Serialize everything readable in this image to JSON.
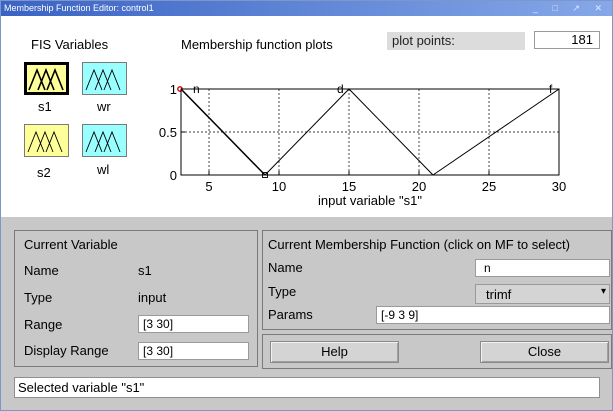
{
  "window": {
    "title": "Membership Function Editor: control1",
    "controls": "_ □ ↗ ✕"
  },
  "fis": {
    "heading": "FIS Variables",
    "variables": [
      {
        "name": "s1",
        "color": "#ffff99",
        "selected": true
      },
      {
        "name": "wr",
        "color": "#99ffff",
        "selected": false
      },
      {
        "name": "s2",
        "color": "#ffff99",
        "selected": false
      },
      {
        "name": "wl",
        "color": "#99ffff",
        "selected": false
      }
    ]
  },
  "plot": {
    "heading": "Membership function plots",
    "plot_points_label": "plot points:",
    "plot_points_value": "181",
    "xlabel": "input variable \"s1\"",
    "xticks": [
      "5",
      "10",
      "15",
      "20",
      "25",
      "30"
    ],
    "yticks": [
      "0",
      "0.5",
      "1"
    ]
  },
  "chart_data": {
    "type": "line",
    "xlabel": "input variable \"s1\"",
    "ylabel": "",
    "xlim": [
      3,
      30
    ],
    "ylim": [
      0,
      1
    ],
    "grid": true,
    "series": [
      {
        "name": "n",
        "x": [
          -9,
          3,
          9
        ],
        "y": [
          0,
          1,
          0
        ]
      },
      {
        "name": "d",
        "x": [
          9,
          15,
          21
        ],
        "y": [
          0,
          1,
          0
        ]
      },
      {
        "name": "f",
        "x": [
          21,
          30
        ],
        "y": [
          0,
          1
        ]
      }
    ]
  },
  "current_variable": {
    "heading": "Current Variable",
    "name_label": "Name",
    "name_value": "s1",
    "type_label": "Type",
    "type_value": "input",
    "range_label": "Range",
    "range_value": "[3 30]",
    "display_range_label": "Display Range",
    "display_range_value": "[3 30]"
  },
  "current_mf": {
    "heading": "Current Membership Function (click on MF to select)",
    "name_label": "Name",
    "name_value": "n",
    "type_label": "Type",
    "type_value": "trimf",
    "params_label": "Params",
    "params_value": "[-9 3 9]"
  },
  "buttons": {
    "help": "Help",
    "close": "Close"
  },
  "status": "Selected variable \"s1\""
}
